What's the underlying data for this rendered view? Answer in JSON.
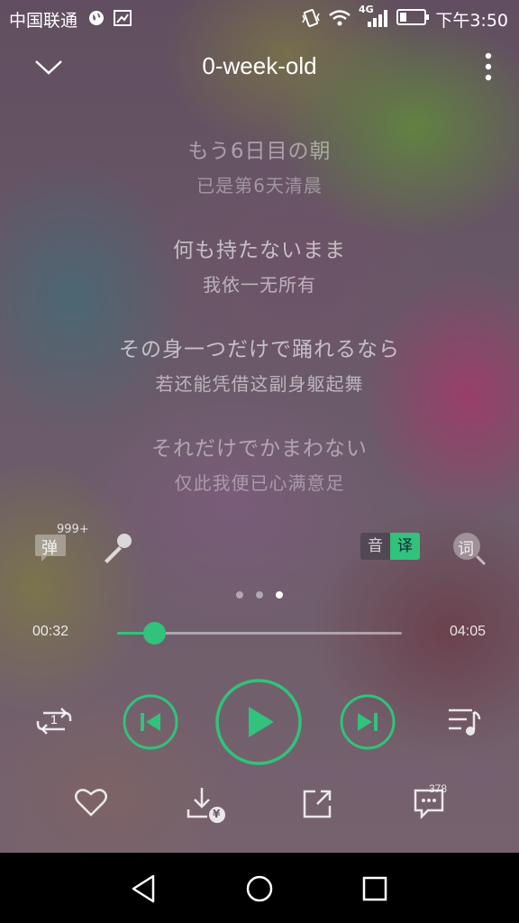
{
  "status_bar": {
    "carrier": "中国联通",
    "network": "4G",
    "time": "下午3:50"
  },
  "header": {
    "title": "0-week-old",
    "back_icon": "chevron-down-icon",
    "more_icon": "more-vertical-icon"
  },
  "lyrics": [
    {
      "jp": "もう6日目の朝",
      "cn": "已是第6天清晨"
    },
    {
      "jp": "何も持たないまま",
      "cn": "我依一无所有"
    },
    {
      "jp": "その身一つだけで踊れるなら",
      "cn": "若还能凭借这副身躯起舞"
    },
    {
      "jp": "それだけでかまわない",
      "cn": "仅此我便已心满意足"
    }
  ],
  "tools": {
    "danmu_label": "弹",
    "danmu_count": "999+",
    "yin_label": "音",
    "yi_label": "译",
    "ci_label": "词"
  },
  "pager": {
    "count": 3,
    "active": 3
  },
  "progress": {
    "current": "00:32",
    "total": "04:05",
    "fraction": 0.13
  },
  "controls": {
    "repeat_badge": "1",
    "accent_color": "#31c27c"
  },
  "bottom": {
    "download_badge": "¥",
    "comments_count": "378"
  }
}
